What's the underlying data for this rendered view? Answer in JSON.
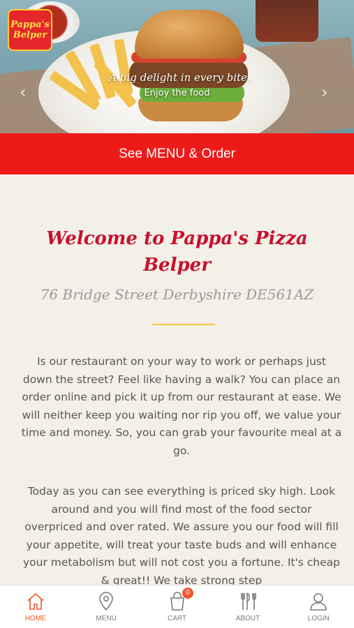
{
  "hero": {
    "brand_line1": "Pappa's",
    "brand_line2": "Belper",
    "tagline": "A big delight in every bite.",
    "subtagline": "Enjoy the food",
    "prev_arrow": "‹",
    "next_arrow": "›"
  },
  "cta": {
    "label": "See MENU & Order"
  },
  "main": {
    "welcome_title": "Welcome to Pappa's Pizza Belper",
    "address": "76 Bridge Street Derbyshire DE561AZ",
    "paragraph1": "Is our restaurant on your way to work or perhaps just down the street? Feel like having a walk? You can place an order online and pick it up from our restaurant at ease. We will neither keep you waiting nor rip you off, we value your time and money. So, you can grab your favourite meal at a go.",
    "paragraph2": "Today as you can see everything is priced sky high. Look around and you will find most of the food sector overpriced and over rated. We assure you our food will fill your appetite, will treat your taste buds and will enhance your metabolism but will not cost you a fortune. It's cheap & great!! We take strong step"
  },
  "nav": {
    "items": [
      {
        "label": "HOME",
        "icon": "home-icon",
        "active": true
      },
      {
        "label": "MENU",
        "icon": "location-pin-icon",
        "active": false
      },
      {
        "label": "CART",
        "icon": "cart-icon",
        "active": false
      },
      {
        "label": "ABOUT",
        "icon": "cutlery-icon",
        "active": false
      },
      {
        "label": "LOGIN",
        "icon": "user-icon",
        "active": false
      }
    ],
    "cart_count": "0"
  },
  "colors": {
    "accent_red": "#ee1a1a",
    "title_red": "#c8102e",
    "active_orange": "#ef5a2a",
    "divider_gold": "#f0c541",
    "background": "#f3f0e8"
  }
}
